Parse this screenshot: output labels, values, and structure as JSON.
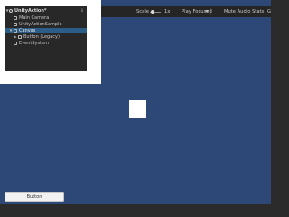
{
  "game_view": {
    "toolbar": {
      "scale_label": "Scale",
      "scale_value": "1x",
      "play_mode_label": "Play Focused",
      "mute_audio_label": "Mute Audio",
      "stats_label": "Stats",
      "gizmos_label": "G"
    },
    "background_color": "#2d4876"
  },
  "hierarchy": {
    "scene_name": "UnityAction*",
    "menu_icon": "kebab-menu-icon",
    "items": [
      {
        "label": "Main Camera",
        "depth": 1,
        "expandable": false,
        "selected": false
      },
      {
        "label": "UnityActionSample",
        "depth": 1,
        "expandable": false,
        "selected": false
      },
      {
        "label": "Canvas",
        "depth": 1,
        "expandable": true,
        "expanded": true,
        "selected": true
      },
      {
        "label": "Button (Legacy)",
        "depth": 2,
        "expandable": true,
        "expanded": false,
        "selected": false
      },
      {
        "label": "EventSystem",
        "depth": 1,
        "expandable": false,
        "selected": false
      }
    ]
  },
  "game_ui": {
    "button_label": "Button"
  }
}
